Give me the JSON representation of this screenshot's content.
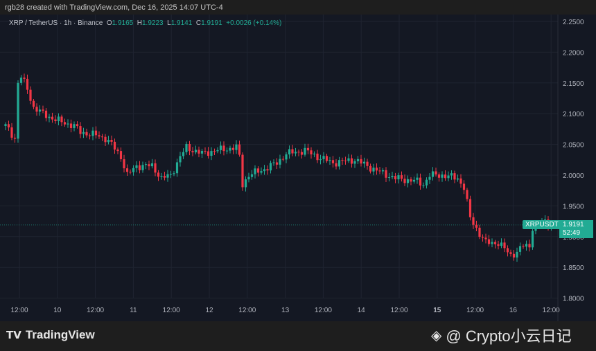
{
  "header": {
    "caption": "rgb28 created with TradingView.com, Dec 16, 2025 14:07 UTC-4"
  },
  "legend": {
    "symbol": "XRP / TetherUS · 1h · Binance",
    "o_label": "O",
    "o": "1.9165",
    "h_label": "H",
    "h": "1.9223",
    "l_label": "L",
    "l": "1.9141",
    "c_label": "C",
    "c": "1.9191",
    "change": "+0.0026 (+0.14%)"
  },
  "price_tag": {
    "symbol": "XRPUSDT",
    "price": "1.9191",
    "countdown": "52:49"
  },
  "footer": {
    "logo": "TradingView",
    "watermark": "@ Crypto小云日记"
  },
  "colors": {
    "up": "#22ab94",
    "down": "#f23645",
    "bg": "#141823"
  },
  "chart_data": {
    "type": "candlestick",
    "interval": "1h",
    "ylim": [
      1.78,
      2.26
    ],
    "y_ticks": [
      "2.2500",
      "2.2000",
      "2.1500",
      "2.1000",
      "2.0500",
      "2.0000",
      "1.9500",
      "1.9000",
      "1.8500",
      "1.8000"
    ],
    "x_ticks": [
      "12:00",
      "10",
      "12:00",
      "11",
      "12:00",
      "12",
      "12:00",
      "13",
      "12:00",
      "14",
      "12:00",
      "15",
      "12:00",
      "16",
      "12:00"
    ],
    "last_price": 1.9191,
    "close_path_hour_price": [
      [
        0,
        2.08
      ],
      [
        3,
        2.06
      ],
      [
        4,
        2.15
      ],
      [
        5,
        2.16
      ],
      [
        7,
        2.14
      ],
      [
        9,
        2.11
      ],
      [
        12,
        2.1
      ],
      [
        16,
        2.09
      ],
      [
        22,
        2.08
      ],
      [
        24,
        2.07
      ],
      [
        29,
        2.065
      ],
      [
        32,
        2.06
      ],
      [
        34,
        2.05
      ],
      [
        37,
        2.03
      ],
      [
        39,
        2.0
      ],
      [
        42,
        2.015
      ],
      [
        47,
        2.015
      ],
      [
        50,
        1.995
      ],
      [
        53,
        2.0
      ],
      [
        56,
        2.03
      ],
      [
        58,
        2.045
      ],
      [
        63,
        2.035
      ],
      [
        67,
        2.04
      ],
      [
        74,
        2.045
      ],
      [
        75,
        2.03
      ],
      [
        76,
        1.985
      ],
      [
        78,
        2.0
      ],
      [
        83,
        2.01
      ],
      [
        87,
        2.02
      ],
      [
        90,
        2.035
      ],
      [
        96,
        2.04
      ],
      [
        100,
        2.03
      ],
      [
        105,
        2.02
      ],
      [
        112,
        2.025
      ],
      [
        116,
        2.015
      ],
      [
        120,
        2.005
      ],
      [
        125,
        1.995
      ],
      [
        132,
        1.99
      ],
      [
        134,
        1.985
      ],
      [
        136,
        2.0
      ],
      [
        140,
        2.0
      ],
      [
        145,
        1.995
      ],
      [
        147,
        1.98
      ],
      [
        149,
        1.93
      ],
      [
        152,
        1.905
      ],
      [
        154,
        1.89
      ],
      [
        158,
        1.89
      ],
      [
        162,
        1.87
      ],
      [
        164,
        1.875
      ],
      [
        166,
        1.885
      ],
      [
        168,
        1.885
      ],
      [
        169,
        1.915
      ],
      [
        173,
        1.925
      ],
      [
        176,
        1.919
      ]
    ]
  }
}
